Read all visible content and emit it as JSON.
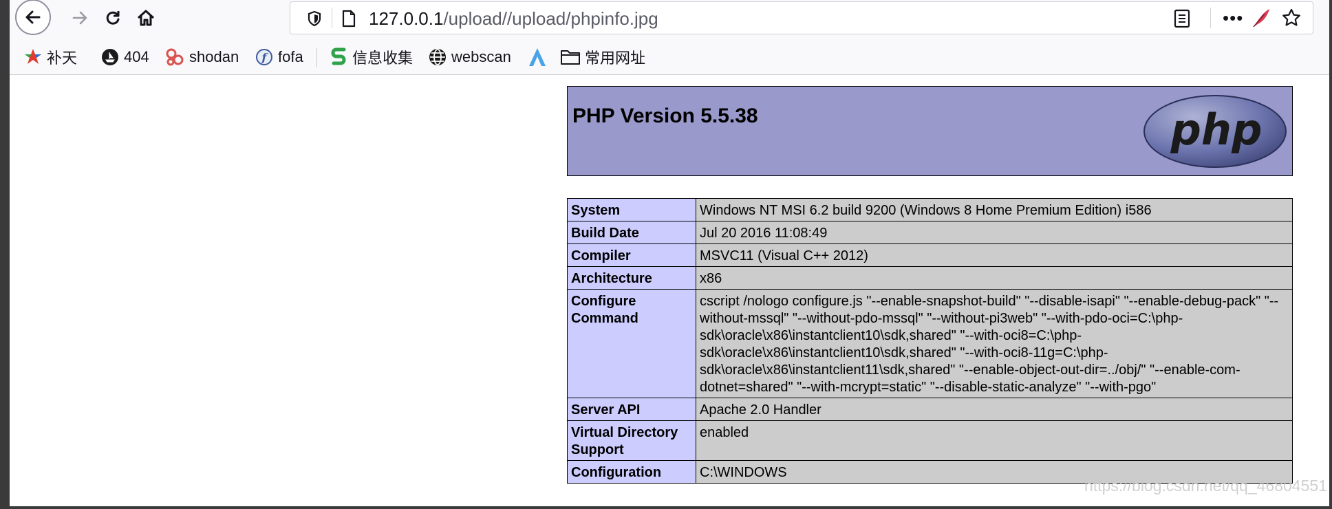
{
  "browser": {
    "url_host": "127.0.0.1",
    "url_path": "/upload//upload/phpinfo.jpg",
    "icons": [
      "back-icon",
      "forward-icon",
      "reload-icon",
      "home-icon",
      "shield-icon",
      "page-icon",
      "reader-view-icon",
      "more-icon",
      "feather-icon",
      "star-icon"
    ]
  },
  "bookmarks": [
    {
      "label": "补天",
      "icon": "star-logo-icon"
    },
    {
      "label": "404",
      "icon": "ship-icon"
    },
    {
      "label": "shodan",
      "icon": "shodan-icon"
    },
    {
      "label": "fofa",
      "icon": "fofa-icon"
    },
    {
      "label": "信息收集",
      "icon": "s-logo-icon"
    },
    {
      "label": "webscan",
      "icon": "globe-icon"
    },
    {
      "label": "",
      "icon": "a-logo-icon"
    },
    {
      "label": "常用网址",
      "icon": "folder-icon"
    }
  ],
  "page": {
    "title": "PHP Version 5.5.38",
    "logo_text": "php",
    "rows": [
      {
        "key": "System",
        "value": "Windows NT MSI 6.2 build 9200 (Windows 8 Home Premium Edition) i586"
      },
      {
        "key": "Build Date",
        "value": "Jul 20 2016 11:08:49"
      },
      {
        "key": "Compiler",
        "value": "MSVC11 (Visual C++ 2012)"
      },
      {
        "key": "Architecture",
        "value": "x86"
      },
      {
        "key": "Configure Command",
        "value": "cscript /nologo configure.js \"--enable-snapshot-build\" \"--disable-isapi\" \"--enable-debug-pack\" \"--without-mssql\" \"--without-pdo-mssql\" \"--without-pi3web\" \"--with-pdo-oci=C:\\php-sdk\\oracle\\x86\\instantclient10\\sdk,shared\" \"--with-oci8=C:\\php-sdk\\oracle\\x86\\instantclient10\\sdk,shared\" \"--with-oci8-11g=C:\\php-sdk\\oracle\\x86\\instantclient11\\sdk,shared\" \"--enable-object-out-dir=../obj/\" \"--enable-com-dotnet=shared\" \"--with-mcrypt=static\" \"--disable-static-analyze\" \"--with-pgo\""
      },
      {
        "key": "Server API",
        "value": "Apache 2.0 Handler"
      },
      {
        "key": "Virtual Directory Support",
        "value": "enabled"
      },
      {
        "key": "Configuration",
        "value": "C:\\WINDOWS"
      }
    ]
  },
  "watermark": "https://blog.csdn.net/qq_46804551",
  "colors": {
    "php_header": "#9999cc",
    "key_cell": "#ccccff",
    "value_cell": "#cccccc"
  }
}
